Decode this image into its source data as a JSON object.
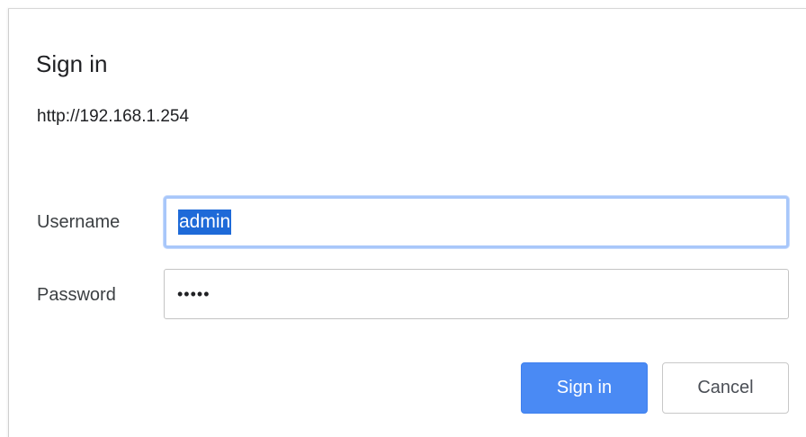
{
  "dialog": {
    "title": "Sign in",
    "url": "http://192.168.1.254"
  },
  "form": {
    "username_label": "Username",
    "username_value": "admin",
    "username_selected": true,
    "password_label": "Password",
    "password_masked": "•••••"
  },
  "buttons": {
    "sign_in_label": "Sign in",
    "cancel_label": "Cancel"
  },
  "colors": {
    "primary_button": "#4a8af4",
    "focus_ring": "#a8c7fa",
    "selection_highlight": "#1e6ad8"
  }
}
